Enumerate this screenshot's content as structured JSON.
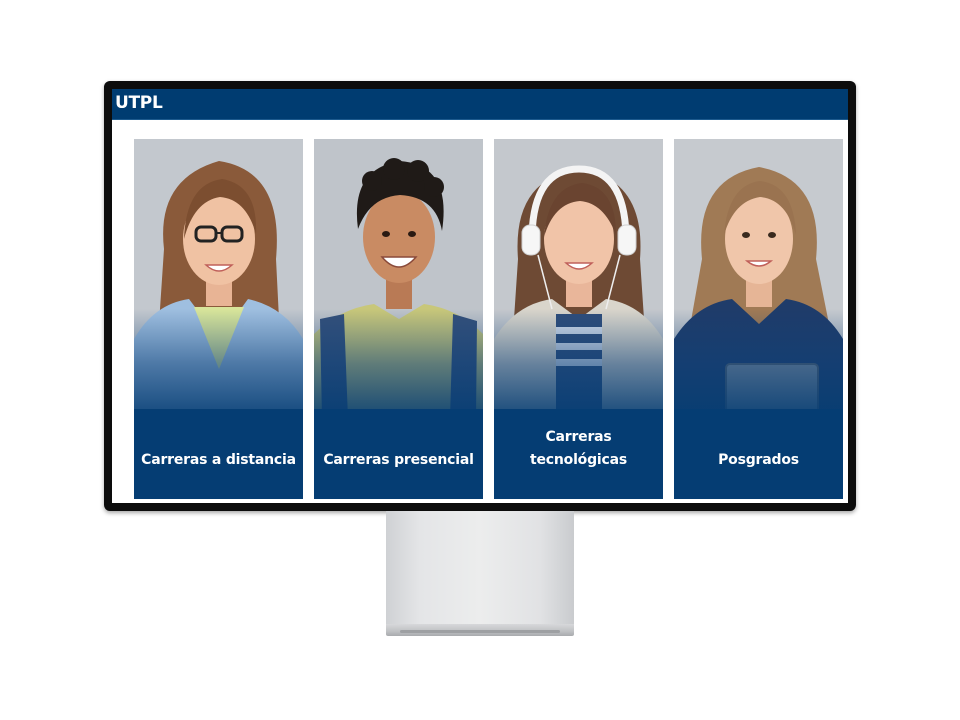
{
  "header": {
    "brand": "UTPL"
  },
  "cards": [
    {
      "label": "Carreras a distancia"
    },
    {
      "label": "Carreras presencial"
    },
    {
      "label_line1": "Carreras",
      "label_line2": "tecnológicas"
    },
    {
      "label": "Posgrados"
    }
  ],
  "colors": {
    "brand_blue": "#003c71",
    "card_panel": "#053d73",
    "bezel": "#0c0c0c",
    "stand": "#e4e5e7"
  }
}
